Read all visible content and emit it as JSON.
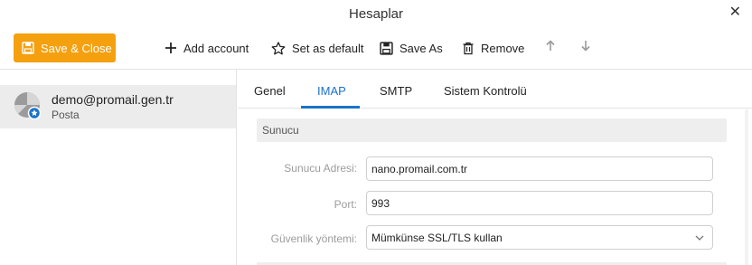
{
  "window": {
    "title": "Hesaplar",
    "close_glyph": "✕"
  },
  "toolbar": {
    "save_close": "Save & Close",
    "add_account": "Add account",
    "set_default": "Set as default",
    "save_as": "Save As",
    "remove": "Remove",
    "up_glyph": "🠕",
    "down_glyph": "🠗"
  },
  "account": {
    "email": "demo@promail.gen.tr",
    "type": "Posta"
  },
  "tabs": [
    {
      "label": "Genel"
    },
    {
      "label": "IMAP"
    },
    {
      "label": "SMTP"
    },
    {
      "label": "Sistem Kontrolü"
    }
  ],
  "active_tab": "IMAP",
  "section_title": "Sunucu",
  "form": {
    "server_label": "Sunucu Adresi:",
    "server_value": "nano.promail.com.tr",
    "port_label": "Port:",
    "port_value": "993",
    "security_label": "Güvenlik yöntemi:",
    "security_value": "Mümkünse SSL/TLS kullan"
  },
  "colors": {
    "accent": "#1a73c8",
    "save_button": "#f5a00f"
  }
}
